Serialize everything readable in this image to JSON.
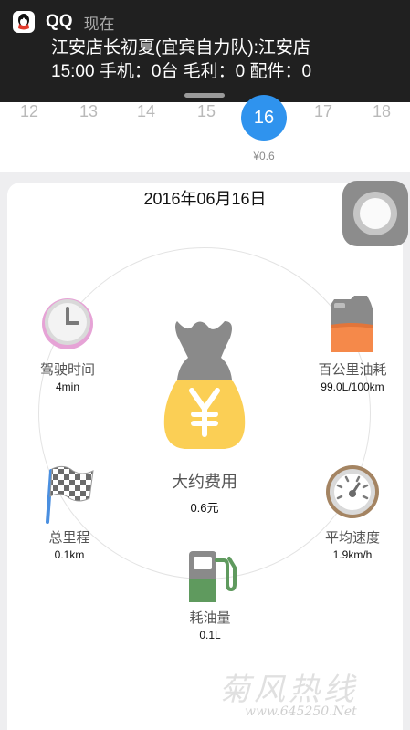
{
  "notification": {
    "app_name": "QQ",
    "time": "现在",
    "line1": "江安店长初夏(宜宾自力队):江安店",
    "line2": "15:00  手机：0台 毛利：0  配件：0"
  },
  "date_strip": {
    "dates": [
      "12",
      "13",
      "14",
      "15",
      "16",
      "17",
      "18"
    ],
    "selected": "16",
    "selected_cost": "¥0.6"
  },
  "trip": {
    "date": "2016年06月16日",
    "center": {
      "label": "大约费用",
      "value": "0.6元",
      "icon": "money-bag-icon"
    },
    "stats": {
      "driving_time": {
        "label": "驾驶时间",
        "value": "4min",
        "icon": "clock-icon"
      },
      "fuel_per_100km": {
        "label": "百公里油耗",
        "value": "99.0L/100km",
        "icon": "fuel-can-icon"
      },
      "total_distance": {
        "label": "总里程",
        "value": "0.1km",
        "icon": "checkered-flag-icon"
      },
      "avg_speed": {
        "label": "平均速度",
        "value": "1.9km/h",
        "icon": "speedometer-icon"
      },
      "fuel_used": {
        "label": "耗油量",
        "value": "0.1L",
        "icon": "fuel-pump-icon"
      }
    }
  },
  "colors": {
    "selected_blue": "#2f93ee",
    "bag_gray": "#8a8a8a",
    "bag_yellow": "#fbcf55",
    "clock_pink": "#e6a3d6",
    "fuel_orange": "#f5894a",
    "pump_green": "#5f9a5e"
  },
  "watermark": {
    "text": "菊风热线",
    "url": "www.645250.Net"
  }
}
